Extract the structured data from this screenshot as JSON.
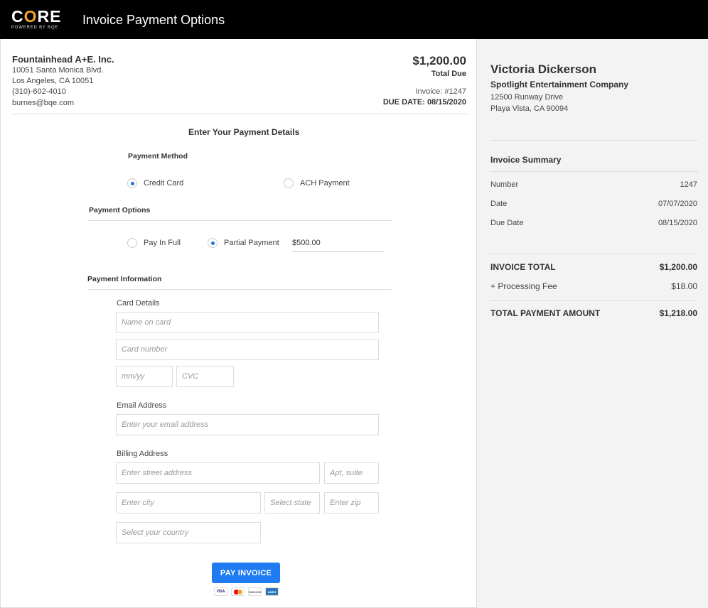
{
  "header": {
    "logo_word_c": "C",
    "logo_word_o": "O",
    "logo_word_re": "RE",
    "logo_sub": "POWERED BY BQE",
    "title": "Invoice Payment Options"
  },
  "vendor": {
    "name": "Fountainhead A+E. Inc.",
    "address1": "10051 Santa Monica Blvd.",
    "address2": "Los Angeles, CA 10051",
    "phone": "(310)-602-4010",
    "email": "burnes@bqe.com"
  },
  "invoice_header": {
    "amount": "$1,200.00",
    "total_due_label": "Total Due",
    "invoice_number": "Invoice: #1247",
    "due_date": "DUE DATE: 08/15/2020"
  },
  "form": {
    "title": "Enter Your Payment Details",
    "payment_method_label": "Payment Method",
    "method_credit_card": "Credit Card",
    "method_ach": "ACH Payment",
    "payment_options_label": "Payment Options",
    "option_full": "Pay In Full",
    "option_partial": "Partial Payment",
    "partial_amount": "$500.00",
    "payment_info_label": "Payment Information",
    "card_details_label": "Card Details",
    "name_on_card_placeholder": "Name on card",
    "card_number_placeholder": "Card number",
    "expiry_placeholder": "mm/yy",
    "cvc_placeholder": "CVC",
    "email_label": "Email Address",
    "email_placeholder": "Enter your email address",
    "billing_label": "Billing Address",
    "street_placeholder": "Enter street address",
    "apt_placeholder": "Apt, suite",
    "city_placeholder": "Enter city",
    "state_placeholder": "Select state",
    "zip_placeholder": "Enter zip",
    "country_placeholder": "Select your country",
    "pay_button": "PAY INVOICE",
    "card_brands": [
      "VISA",
      "mastercard",
      "DISCOVER",
      "AMEX"
    ]
  },
  "client": {
    "name": "Victoria Dickerson",
    "company": "Spotlight Entertainment Company",
    "address1": "12500 Runway Drive",
    "address2": "Playa Vista, CA 90094"
  },
  "summary": {
    "title": "Invoice Summary",
    "rows": [
      {
        "label": "Number",
        "value": "1247"
      },
      {
        "label": "Date",
        "value": "07/07/2020"
      },
      {
        "label": "Due Date",
        "value": "08/15/2020"
      }
    ],
    "invoice_total_label": "INVOICE TOTAL",
    "invoice_total_value": "$1,200.00",
    "fee_label": "+ Processing Fee",
    "fee_value": "$18.00",
    "payment_total_label": "TOTAL PAYMENT AMOUNT",
    "payment_total_value": "$1,218.00"
  },
  "colors": {
    "accent": "#1f7bf2",
    "logo_o": "#f5a623",
    "topbar": "#000000",
    "sidebar_bg": "#f3f3f3"
  }
}
